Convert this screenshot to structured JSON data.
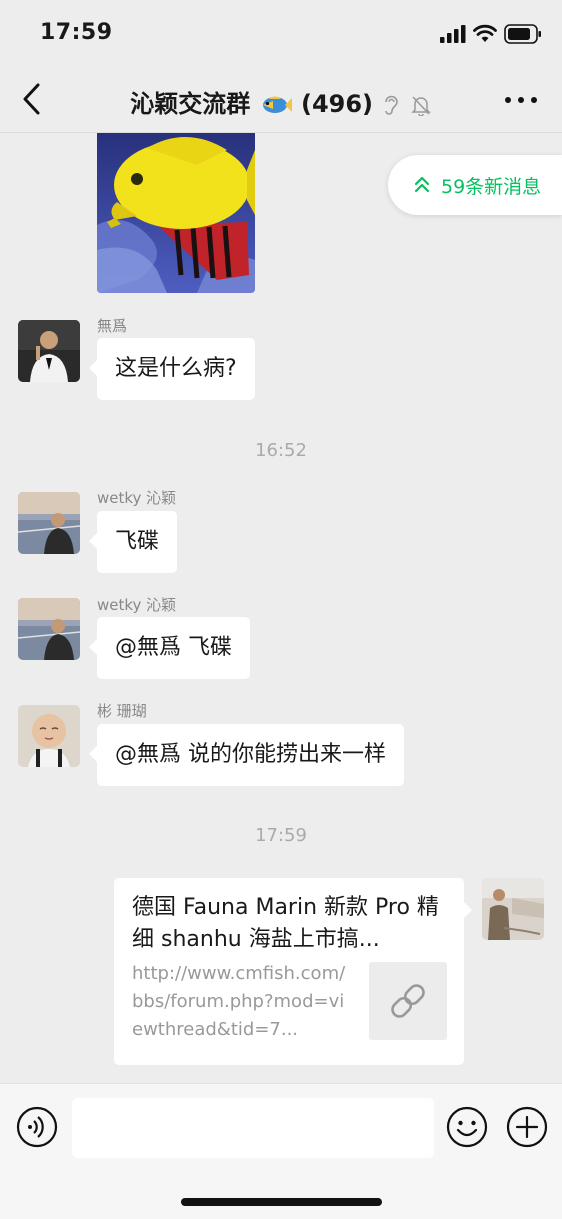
{
  "status": {
    "time": "17:59"
  },
  "header": {
    "title": "沁颖交流群",
    "count": "(496)"
  },
  "new_messages": {
    "label": "59条新消息"
  },
  "messages": [
    {
      "sender": "無爲",
      "text": "这是什么病?"
    },
    {
      "timestamp": "16:52"
    },
    {
      "sender": "wetky 沁颖",
      "text": "飞碟"
    },
    {
      "sender": "wetky 沁颖",
      "text": "@無爲 飞碟"
    },
    {
      "sender": "彬 珊瑚",
      "text": "@無爲 说的你能捞出来一样"
    },
    {
      "timestamp": "17:59"
    },
    {
      "link_title": "德国 Fauna Marin 新款 Pro 精细 shanhu 海盐上市搞...",
      "link_desc": "http://www.cmfish.com/bbs/forum.php?mod=viewthread&tid=7..."
    }
  ],
  "input": {
    "placeholder": ""
  },
  "colors": {
    "accent": "#07c160",
    "bg": "#ededed",
    "bubble": "#ffffff"
  },
  "icons": [
    "back-icon",
    "fish-emoji-icon",
    "ear-icon",
    "mute-bell-icon",
    "more-icon",
    "double-chevron-up-icon",
    "link-icon",
    "voice-icon",
    "emoji-icon",
    "plus-icon"
  ]
}
